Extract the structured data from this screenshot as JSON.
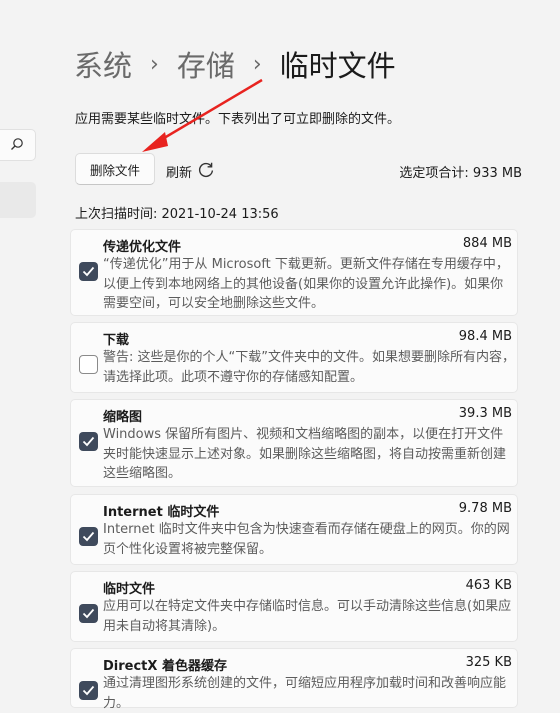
{
  "breadcrumb": {
    "items": [
      "系统",
      "存储"
    ],
    "current": "临时文件",
    "separator": "›"
  },
  "description": "应用需要某些临时文件。下表列出了可立即删除的文件。",
  "toolbar": {
    "delete_label": "删除文件",
    "refresh_label": "刷新",
    "selected_total": "选定项合计: 933 MB"
  },
  "last_scan": "上次扫描时间: 2021-10-24 13:56",
  "items": [
    {
      "title": "传递优化文件",
      "size": "884 MB",
      "checked": true,
      "desc": "“传递优化”用于从 Microsoft 下载更新。更新文件存储在专用缓存中，以便上传到本地网络上的其他设备(如果你的设置允许此操作)。如果你需要空间，可以安全地删除这些文件。"
    },
    {
      "title": "下载",
      "size": "98.4 MB",
      "checked": false,
      "desc": "警告: 这些是你的个人“下载”文件夹中的文件。如果想要删除所有内容，请选择此项。此项不遵守你的存储感知配置。"
    },
    {
      "title": "缩略图",
      "size": "39.3 MB",
      "checked": true,
      "desc": "Windows 保留所有图片、视频和文档缩略图的副本，以便在打开文件夹时能快速显示上述对象。如果删除这些缩略图，将自动按需重新创建这些缩略图。"
    },
    {
      "title": "Internet 临时文件",
      "size": "9.78 MB",
      "checked": true,
      "desc": "Internet 临时文件夹中包含为快速查看而存储在硬盘上的网页。你的网页个性化设置将被完整保留。"
    },
    {
      "title": "临时文件",
      "size": "463 KB",
      "checked": true,
      "desc": "应用可以在特定文件夹中存储临时信息。可以手动清除这些信息(如果应用未自动将其清除)。"
    },
    {
      "title": "DirectX 着色器缓存",
      "size": "325 KB",
      "checked": true,
      "desc": "通过清理图形系统创建的文件，可缩短应用程序加载时间和改善响应能力。"
    }
  ],
  "colors": {
    "background": "#f3f3f3",
    "card": "#fbfbfb",
    "checkbox_checked": "#3f4a5c",
    "annotation_arrow": "#e8231f"
  }
}
